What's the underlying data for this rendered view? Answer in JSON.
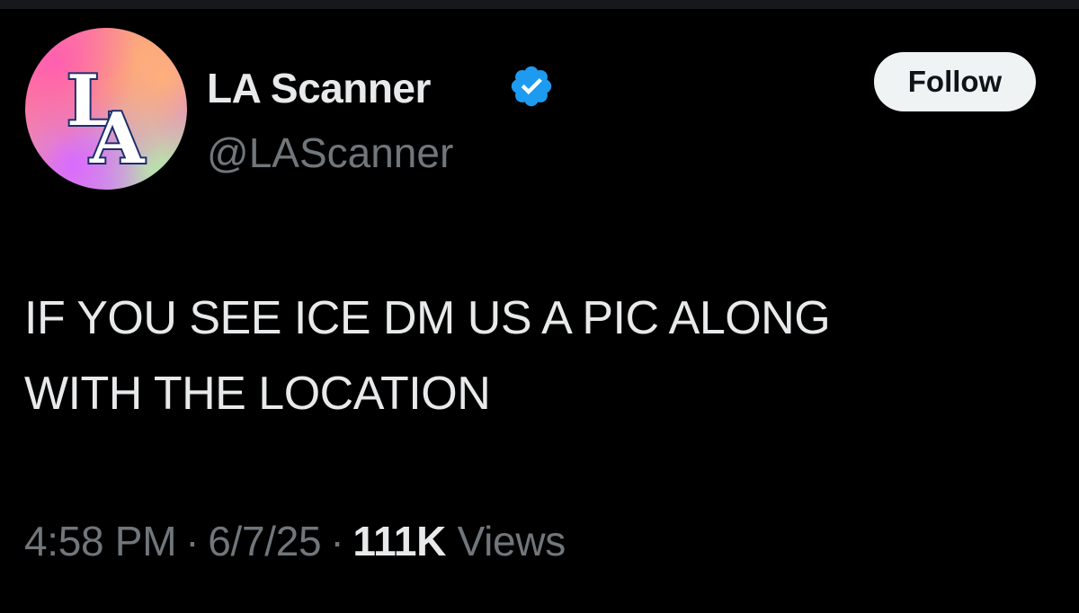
{
  "tweet": {
    "author": {
      "display_name": "LA Scanner",
      "handle": "@LAScanner",
      "verified": true,
      "avatar_text": "LA",
      "avatar_icon": "la-logo-icon"
    },
    "follow_label": "Follow",
    "text_lines": [
      "IF YOU SEE ICE DM US A PIC ALONG",
      "WITH THE LOCATION"
    ],
    "time": "4:58 PM",
    "separator": "·",
    "date": "6/7/25",
    "views_count": "111K",
    "views_label": "Views"
  },
  "colors": {
    "background": "#000000",
    "primary_text": "#e7e9ea",
    "secondary_text": "#71767b",
    "verified_blue": "#1d9bf0",
    "follow_button_bg": "#eff3f4",
    "follow_button_text": "#0f1419"
  }
}
